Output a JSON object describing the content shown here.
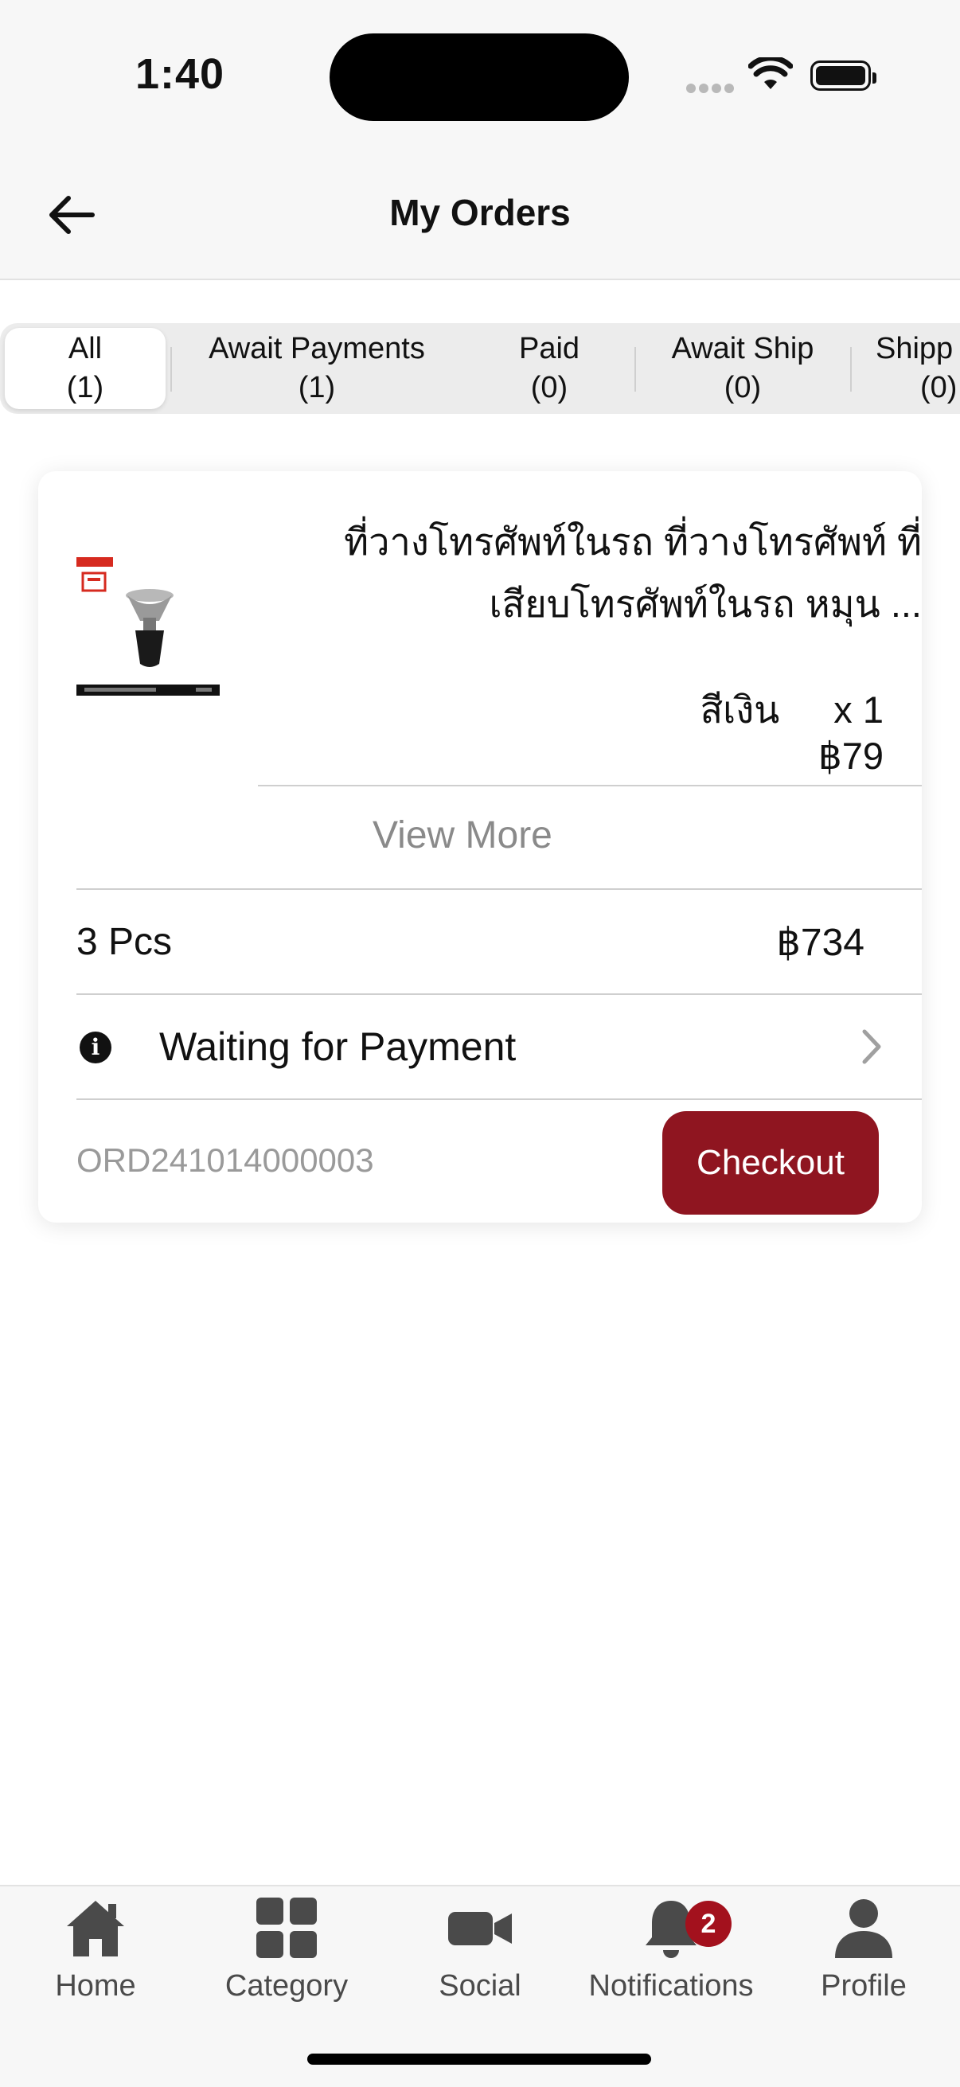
{
  "status_bar": {
    "time": "1:40"
  },
  "header": {
    "title": "My Orders"
  },
  "tabs": [
    {
      "label": "All",
      "count": "(1)",
      "active": true
    },
    {
      "label": "Await Payments",
      "count": "(1)"
    },
    {
      "label": "Paid",
      "count": "(0)"
    },
    {
      "label": "Await Ship",
      "count": "(0)"
    },
    {
      "label": "Shipp",
      "count": "(0)"
    }
  ],
  "order": {
    "product_name": "ที่วางโทรศัพท์ในรถ ที่วางโทรศัพท์ ที่เสียบโทรศัพท์ในรถ หมุน ...",
    "variant": "สีเงิน",
    "quantity": "x 1",
    "price": "฿79",
    "view_more": "View More",
    "pieces": "3 Pcs",
    "total": "฿734",
    "status": "Waiting for Payment",
    "order_id": "ORD241014000003",
    "checkout_label": "Checkout"
  },
  "bottom_nav": [
    {
      "label": "Home",
      "icon": "home-icon"
    },
    {
      "label": "Category",
      "icon": "category-icon"
    },
    {
      "label": "Social",
      "icon": "video-camera-icon"
    },
    {
      "label": "Notifications",
      "icon": "bell-icon",
      "badge": "2"
    },
    {
      "label": "Profile",
      "icon": "person-icon"
    }
  ],
  "colors": {
    "accent": "#8f1520",
    "badge": "#a3111d",
    "muted_text": "#8a8a8a"
  }
}
